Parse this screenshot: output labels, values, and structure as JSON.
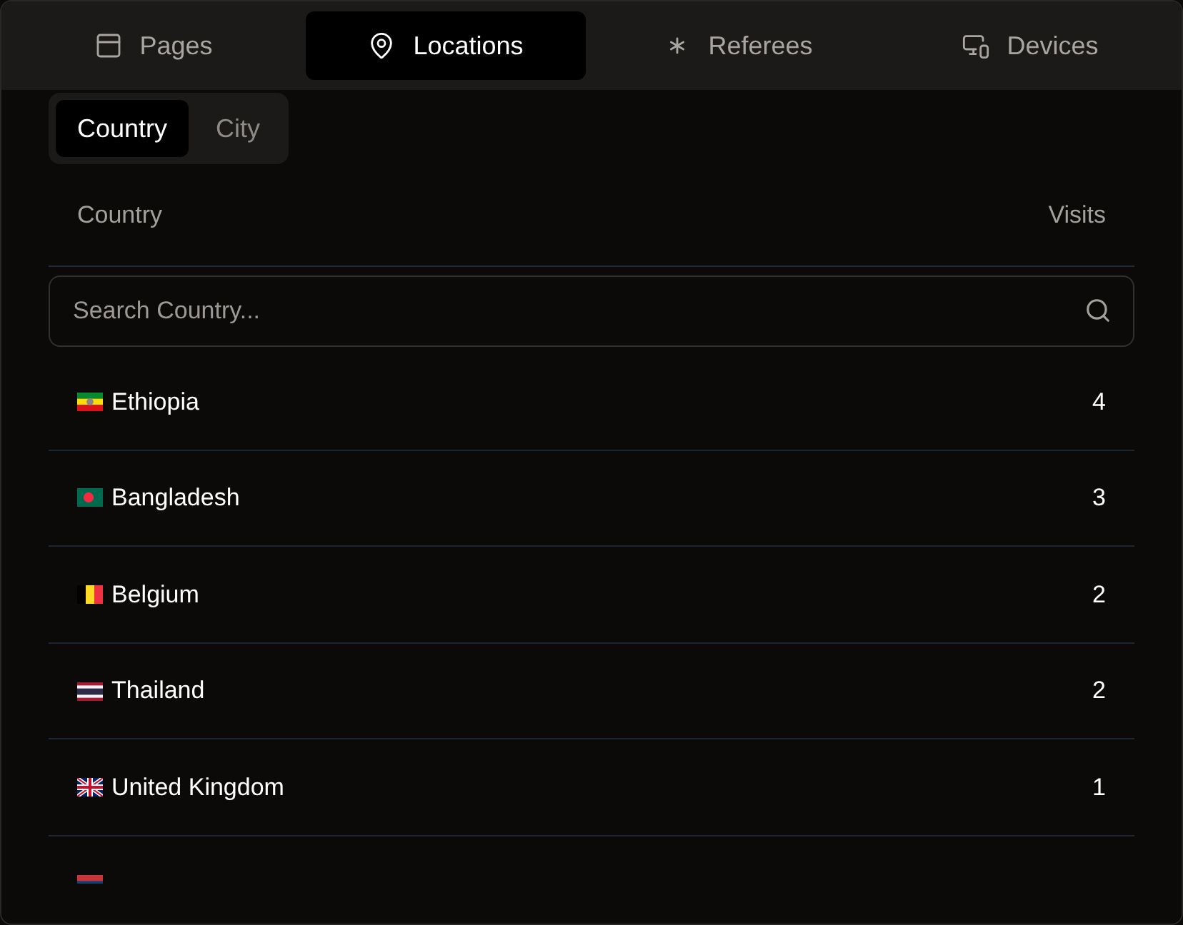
{
  "tabs": [
    {
      "label": "Pages",
      "selected": false
    },
    {
      "label": "Locations",
      "selected": true
    },
    {
      "label": "Referees",
      "selected": false
    },
    {
      "label": "Devices",
      "selected": false
    }
  ],
  "segments": [
    {
      "label": "Country",
      "selected": true
    },
    {
      "label": "City",
      "selected": false
    }
  ],
  "table": {
    "columns": [
      "Country",
      "Visits"
    ],
    "search": {
      "placeholder": "Search Country..."
    },
    "rows": [
      {
        "kind": "et",
        "name": "Ethiopia",
        "visits": "4"
      },
      {
        "kind": "bd",
        "name": "Bangladesh",
        "visits": "3"
      },
      {
        "kind": "be",
        "name": "Belgium",
        "visits": "2"
      },
      {
        "kind": "th",
        "name": "Thailand",
        "visits": "2"
      },
      {
        "kind": "gb",
        "name": "United Kingdom",
        "visits": "1"
      },
      {
        "kind": "rs"
      }
    ]
  }
}
